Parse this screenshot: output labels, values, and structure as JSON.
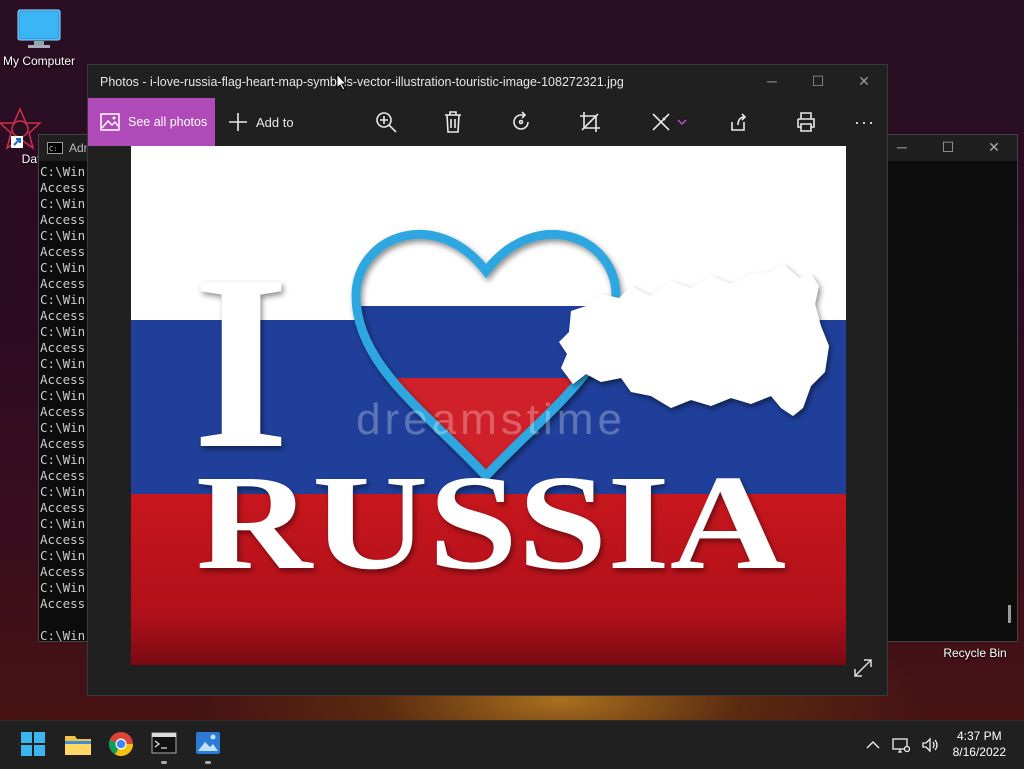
{
  "desktop": {
    "my_computer_label": "My Computer",
    "datawatch_label": "DataW",
    "recycle_bin_label": "Recycle Bin"
  },
  "cmd": {
    "title": "Adm",
    "lines": [
      "C:\\Win",
      "Access",
      "C:\\Win",
      "Access",
      "C:\\Win",
      "Access",
      "C:\\Win",
      "Access",
      "C:\\Win",
      "Access",
      "C:\\Win",
      "Access",
      "C:\\Win",
      "Access",
      "C:\\Win",
      "Access",
      "C:\\Win",
      "Access",
      "C:\\Win",
      "Access",
      "C:\\Win",
      "Access",
      "C:\\Win",
      "Access",
      "C:\\Win",
      "Access",
      "C:\\Win",
      "Access",
      "",
      "C:\\Win"
    ]
  },
  "photos": {
    "title": "Photos - i-love-russia-flag-heart-map-symbols-vector-illustration-touristic-image-108272321.jpg",
    "see_all_label": "See all photos",
    "add_to_label": "Add to",
    "image": {
      "letter_i": "I",
      "word": "RUSSIA",
      "watermark": "dreamstime",
      "colors": {
        "white": "#ffffff",
        "blue": "#1f3f9a",
        "red": "#c8161d",
        "heart": "#2fa7e0"
      }
    }
  },
  "taskbar": {
    "time": "4:37 PM",
    "date": "8/16/2022"
  },
  "colors": {
    "accent": "#b04ab8",
    "window_bg": "#202020"
  }
}
